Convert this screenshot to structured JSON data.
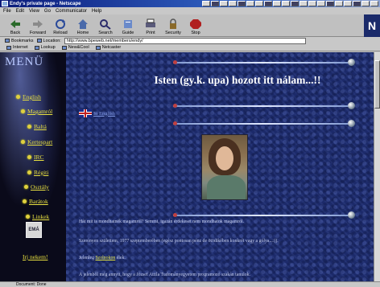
{
  "window": {
    "title": "Endy's private page - Netscape"
  },
  "menubar": [
    "File",
    "Edit",
    "View",
    "Go",
    "Communicator",
    "Help"
  ],
  "toolbar": [
    {
      "label": "Back",
      "icon": "back-arrow-icon"
    },
    {
      "label": "Forward",
      "icon": "forward-arrow-icon"
    },
    {
      "label": "Reload",
      "icon": "reload-icon"
    },
    {
      "label": "Home",
      "icon": "home-icon"
    },
    {
      "label": "Search",
      "icon": "search-icon"
    },
    {
      "label": "Guide",
      "icon": "guide-icon"
    },
    {
      "label": "Print",
      "icon": "print-icon"
    },
    {
      "label": "Security",
      "icon": "lock-icon"
    },
    {
      "label": "Stop",
      "icon": "stop-icon"
    }
  ],
  "brand": "N",
  "location": {
    "bookmarks_label": "Bookmarks",
    "location_label": "Location:",
    "url": "http://www.bpeweb.net/members/endy/"
  },
  "personal_toolbar": [
    "Internet",
    "Lookup",
    "New&Cool",
    "Netcaster"
  ],
  "sidebar": {
    "title": "MENÜ",
    "items": [
      "English",
      "Magamról",
      "Baltá",
      "Kertespart",
      "IRC",
      "Régiti",
      "Osztály",
      "Barátok",
      "Linkek"
    ],
    "emblem": "EMÁ",
    "write_link": "Irj nekem!"
  },
  "main": {
    "heading": "Isten (gy.k. upa) hozott itt nálam...!!",
    "language_link": "In English",
    "paragraph1": "Hát mit is mondhatnék magamról? Semmi, igazán érdekeset nem mondhatok magamról.",
    "paragraph2": "Szerényen születtem, 1977 szeptemberében (egész pontosan pénz de ötödikében konkrét vagy a gólya...:)).",
    "paragraph3_prefix": "Jelenleg",
    "paragraph3_link": "Szolnokon",
    "paragraph3_suffix": "élek.",
    "paragraph4": "A jelenből még annyit, hogy a József Attila Tudományegyetem programozó szakán tanulok."
  },
  "status": {
    "text": "Document: Done"
  }
}
